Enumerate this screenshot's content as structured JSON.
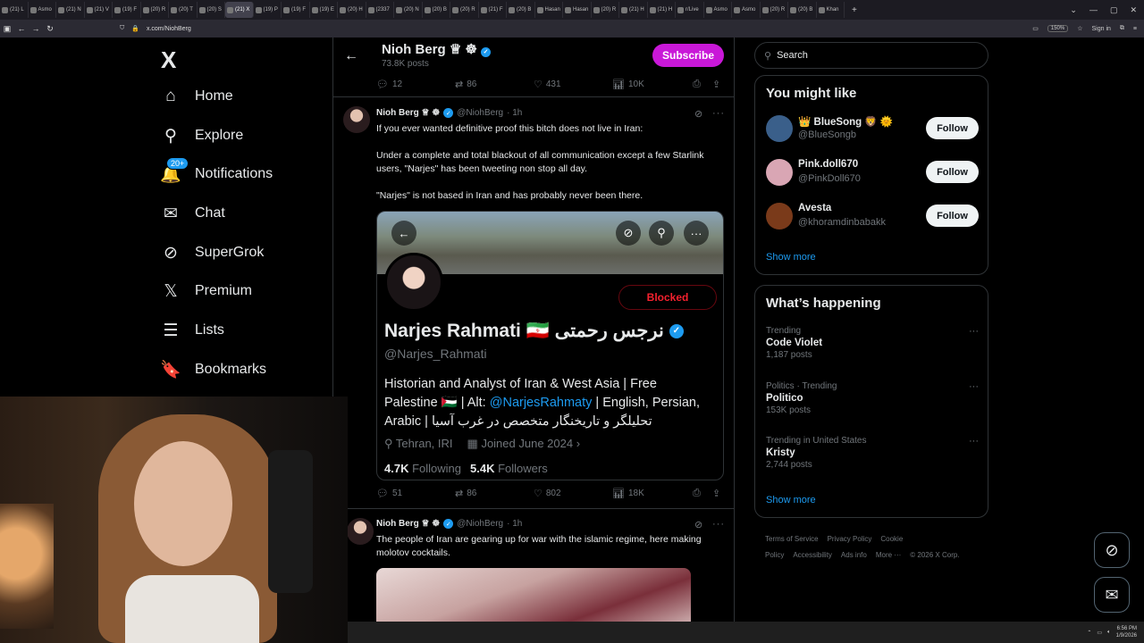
{
  "browser": {
    "tabs": [
      "(21) L",
      "Asmo",
      "(21) N",
      "(21) V",
      "(19) F",
      "(20) R",
      "(20) T",
      "(20) S",
      "(21) X",
      "(19) P",
      "(19) F",
      "(19) E",
      "(20) H",
      "(2337",
      "(20) N",
      "(20) B",
      "(20) R",
      "(21) F",
      "(20) B",
      "Hasan",
      "Hasan",
      "(20) R",
      "(21) H",
      "(21) H",
      "r/Live",
      "Asmo",
      "Asmo",
      "(20) R",
      "(20) B",
      "Khan"
    ],
    "active_tab_index": 8,
    "url": "x.com/NiohBerg",
    "zoom": "150%",
    "sign_in": "Sign in"
  },
  "sidebar": {
    "logo": "X",
    "notif_badge": "20+",
    "items": [
      {
        "label": "Home",
        "icon": "home-icon",
        "glyph": "⌂"
      },
      {
        "label": "Explore",
        "icon": "search-icon",
        "glyph": "⚲"
      },
      {
        "label": "Notifications",
        "icon": "bell-icon",
        "glyph": "🔔"
      },
      {
        "label": "Chat",
        "icon": "mail-icon",
        "glyph": "✉"
      },
      {
        "label": "SuperGrok",
        "icon": "grok-icon",
        "glyph": "⊘"
      },
      {
        "label": "Premium",
        "icon": "x-premium-icon",
        "glyph": "𝕏"
      },
      {
        "label": "Lists",
        "icon": "list-icon",
        "glyph": "☰"
      },
      {
        "label": "Bookmarks",
        "icon": "bookmark-icon",
        "glyph": "🔖"
      }
    ]
  },
  "header": {
    "name": "Nioh Berg ♕ ☸",
    "posts": "73.8K posts",
    "subscribe": "Subscribe"
  },
  "prev_actions": {
    "replies": "12",
    "reposts": "86",
    "likes": "431",
    "views": "10K"
  },
  "tweet1": {
    "name": "Nioh Berg ♕ ☸",
    "handle": "@NiohBerg",
    "time": "· 1h",
    "p1": "If you ever wanted definitive proof this bitch does not live in Iran:",
    "p2": "Under a complete and total blackout of all communication except a few Starlink users, \"Narjes\" has been tweeting non stop all day.",
    "p3": "\"Narjes\" is not based in Iran and has probably never been there.",
    "actions": {
      "replies": "51",
      "reposts": "86",
      "likes": "802",
      "views": "18K"
    }
  },
  "embed": {
    "blocked": "Blocked",
    "name": "Narjes Rahmati 🇮🇷 نرجس رحمتی",
    "handle": "@Narjes_Rahmati",
    "bio_line1": "Historian and Analyst of Iran & West Asia | Free",
    "bio_line2_a": "Palestine 🇵🇸 | Alt: ",
    "bio_link": "@NarjesRahmaty",
    "bio_line2_b": " | English, Persian,",
    "bio_line3": "Arabic | تحلیلگر و تاریخنگار متخصص در غرب آسیا",
    "location": "Tehran, IRI",
    "joined": "Joined June 2024",
    "following_count": "4.7K",
    "following_label": "Following",
    "followers_count": "5.4K",
    "followers_label": "Followers"
  },
  "tweet2": {
    "name": "Nioh Berg ♕ ☸",
    "handle": "@NiohBerg",
    "time": "· 1h",
    "text": "The people of Iran are gearing up for war with the islamic regime, here making molotov cocktails."
  },
  "right": {
    "search_placeholder": "Search",
    "wtf_title": "You might like",
    "follow_label": "Follow",
    "suggestions": [
      {
        "name": "👑 BlueSong 🦁 🌞",
        "handle": "@BlueSongb",
        "color": "#3a5f8a"
      },
      {
        "name": "Pink.doll670",
        "handle": "@PinkDoll670",
        "color": "#d9a6b4"
      },
      {
        "name": "Avesta",
        "handle": "@khoramdinbabakk",
        "color": "#7a3a1a"
      }
    ],
    "show_more": "Show more",
    "happening_title": "What’s happening",
    "trends": [
      {
        "context": "Trending",
        "title": "Code Violet",
        "count": "1,187 posts"
      },
      {
        "context": "Politics · Trending",
        "title": "Politico",
        "count": "153K posts"
      },
      {
        "context": "Trending in United States",
        "title": "Kristy",
        "count": "2,744 posts"
      }
    ],
    "footer": [
      "Terms of Service",
      "Privacy Policy",
      "Cookie Policy",
      "Accessibility",
      "Ads info",
      "More ···",
      "© 2026 X Corp."
    ]
  },
  "taskbar": {
    "time": "6:56 PM",
    "date": "1/9/2026"
  }
}
